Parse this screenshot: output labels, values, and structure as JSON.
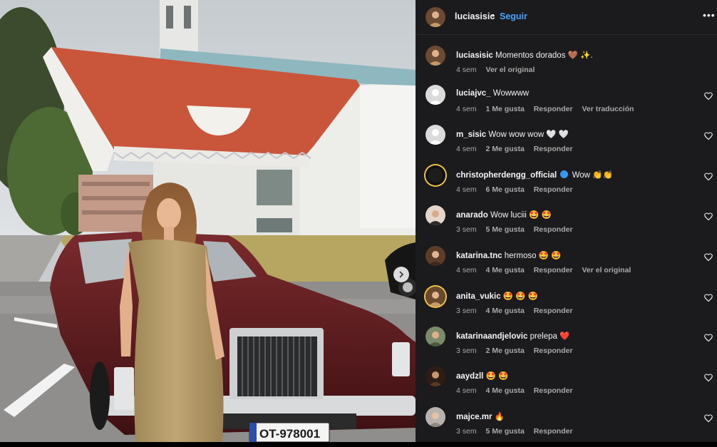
{
  "post": {
    "author": "luciasisic",
    "separator": "•",
    "follow_label": "Seguir",
    "more_label": "•••",
    "plate_text": "OT-978001",
    "caption": {
      "username": "luciasisic",
      "text": "Momentos dorados 🤎 ✨.",
      "time": "4 sem",
      "action": "Ver el original"
    }
  },
  "comments": [
    {
      "username": "luciajvc_",
      "text": "Wowwww",
      "time": "4 sem",
      "likes": "1 Me gusta",
      "reply": "Responder",
      "extra": "Ver traducción"
    },
    {
      "username": "m_sisic",
      "text": "Wow wow wow 🤍 🤍",
      "time": "4 sem",
      "likes": "2 Me gusta",
      "reply": "Responder",
      "extra": ""
    },
    {
      "username": "christopherdengg_official",
      "text": "Wow 👏👏",
      "time": "4 sem",
      "likes": "6 Me gusta",
      "reply": "Responder",
      "extra": ""
    },
    {
      "username": "anarado",
      "text": "Wow luciii 🤩 🤩",
      "time": "3 sem",
      "likes": "5 Me gusta",
      "reply": "Responder",
      "extra": ""
    },
    {
      "username": "katarina.tnc",
      "text": "hermoso 🤩 🤩",
      "time": "4 sem",
      "likes": "4 Me gusta",
      "reply": "Responder",
      "extra": "Ver el original"
    },
    {
      "username": "anita_vukic",
      "text": "🤩 🤩 🤩",
      "time": "3 sem",
      "likes": "4 Me gusta",
      "reply": "Responder",
      "extra": ""
    },
    {
      "username": "katarinaandjelovic",
      "text": "prelepa ❤️",
      "time": "3 sem",
      "likes": "2 Me gusta",
      "reply": "Responder",
      "extra": ""
    },
    {
      "username": "aaydzll",
      "text": "🤩 🤩",
      "time": "4 sem",
      "likes": "4 Me gusta",
      "reply": "Responder",
      "extra": ""
    },
    {
      "username": "majce.mr",
      "text": "🔥",
      "time": "3 sem",
      "likes": "5 Me gusta",
      "reply": "Responder",
      "extra": ""
    }
  ],
  "colors": {
    "panel_bg": "#1b1b1d",
    "follow": "#4aa3ff",
    "muted_text": "#a8a8a8",
    "roof": "#c9553a",
    "car": "#5a1a1c",
    "dress": "#b49a6a"
  },
  "icons": {
    "heart": "heart-outline-icon",
    "more": "more-horizontal-icon",
    "next": "chevron-right-icon",
    "verified": "verified-badge-icon"
  }
}
